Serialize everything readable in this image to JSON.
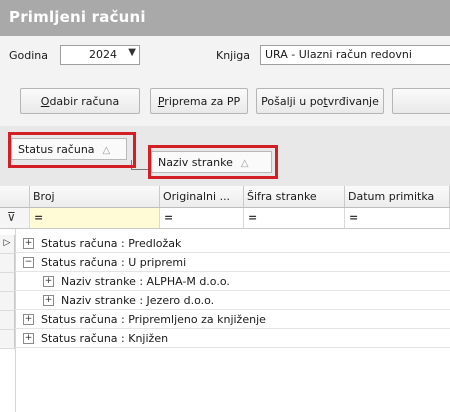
{
  "window": {
    "title": "Primljeni računi"
  },
  "filters": {
    "year_label": "Godina",
    "year_value": "2024",
    "book_label": "Knjiga",
    "book_value": "URA - Ulazni račun redovni"
  },
  "toolbar": {
    "select_invoice": {
      "accel": "O",
      "rest": "dabir računa"
    },
    "prepare_pp": {
      "accel": "P",
      "rest": "riprema za PP"
    },
    "send_approval": {
      "pre": "Pošalji u po",
      "accel": "t",
      "rest": "vrđivanje"
    }
  },
  "group_panel": {
    "chips": [
      {
        "label": "Status računa",
        "sort_glyph": "△"
      },
      {
        "label": "Naziv stranke",
        "sort_glyph": "△"
      }
    ]
  },
  "grid": {
    "columns": [
      "Broj",
      "Originalni ...",
      "Šifra stranke",
      "Datum primitka"
    ],
    "filter_symbol": "=",
    "filter_icon_glyph": "⊽",
    "row_pointer_glyph": "▷",
    "expanded_glyph": "−",
    "collapsed_glyph": "+",
    "rows": [
      {
        "text": "Status računa : Predložak",
        "level": 0,
        "expanded": false,
        "current": true
      },
      {
        "text": "Status računa : U pripremi",
        "level": 0,
        "expanded": true,
        "current": false
      },
      {
        "text": "Naziv stranke : ALPHA-M d.o.o.",
        "level": 1,
        "expanded": false,
        "current": false
      },
      {
        "text": "Naziv stranke : Jezero d.o.o.",
        "level": 1,
        "expanded": false,
        "current": false
      },
      {
        "text": "Status računa : Pripremljeno za knjiženje",
        "level": 0,
        "expanded": false,
        "current": false
      },
      {
        "text": "Status računa : Knjižen",
        "level": 0,
        "expanded": false,
        "current": false
      }
    ]
  },
  "colors": {
    "title_bar": "#a9a9a9",
    "highlight_border": "#d21f26",
    "filter_row": "#fffbd6"
  }
}
